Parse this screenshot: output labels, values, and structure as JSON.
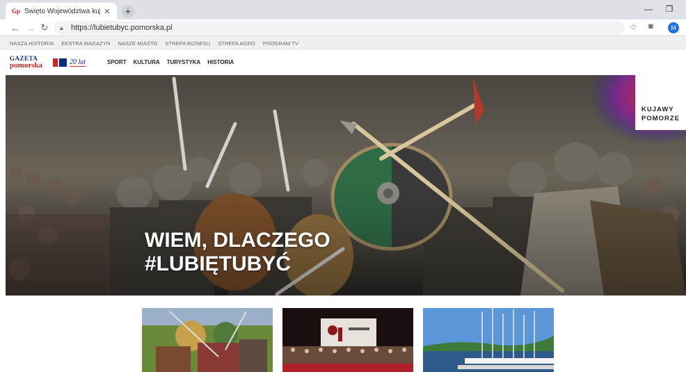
{
  "browser": {
    "tab_title": "Święto Województwa kujawsko-p",
    "tab_favicon": "Gp",
    "url": "https://lubietubyc.pomorska.pl",
    "profile_initial": "M"
  },
  "toplinks": [
    "NASZA HISTORIA",
    "EKSTRA MAGAZYN",
    "NASZE MIASTO",
    "STREFA BIZNESU",
    "STREFA AGRO",
    "PROGRAM TV"
  ],
  "site": {
    "logo_line1": "GAZETA",
    "logo_line2": "pomorska",
    "anniversary": "20 lat",
    "nav": [
      "SPORT",
      "KULTURA",
      "TURYSTYKA",
      "HISTORIA"
    ]
  },
  "hero": {
    "title_line1": "WIEM, DLACZEGO",
    "title_line2": "#LUBIĘTUBYĆ",
    "brand_line1": "KUJAWY",
    "brand_line2": "POMORZE"
  },
  "colors": {
    "brand_red": "#c62828",
    "brand_blue": "#0b2a7a",
    "chrome_blue": "#1a73e8"
  },
  "icons": [
    "back-icon",
    "forward-icon",
    "reload-icon",
    "lock-icon",
    "star-icon",
    "camera-icon",
    "close-icon",
    "plus-icon",
    "minimize-icon",
    "maximize-icon"
  ]
}
